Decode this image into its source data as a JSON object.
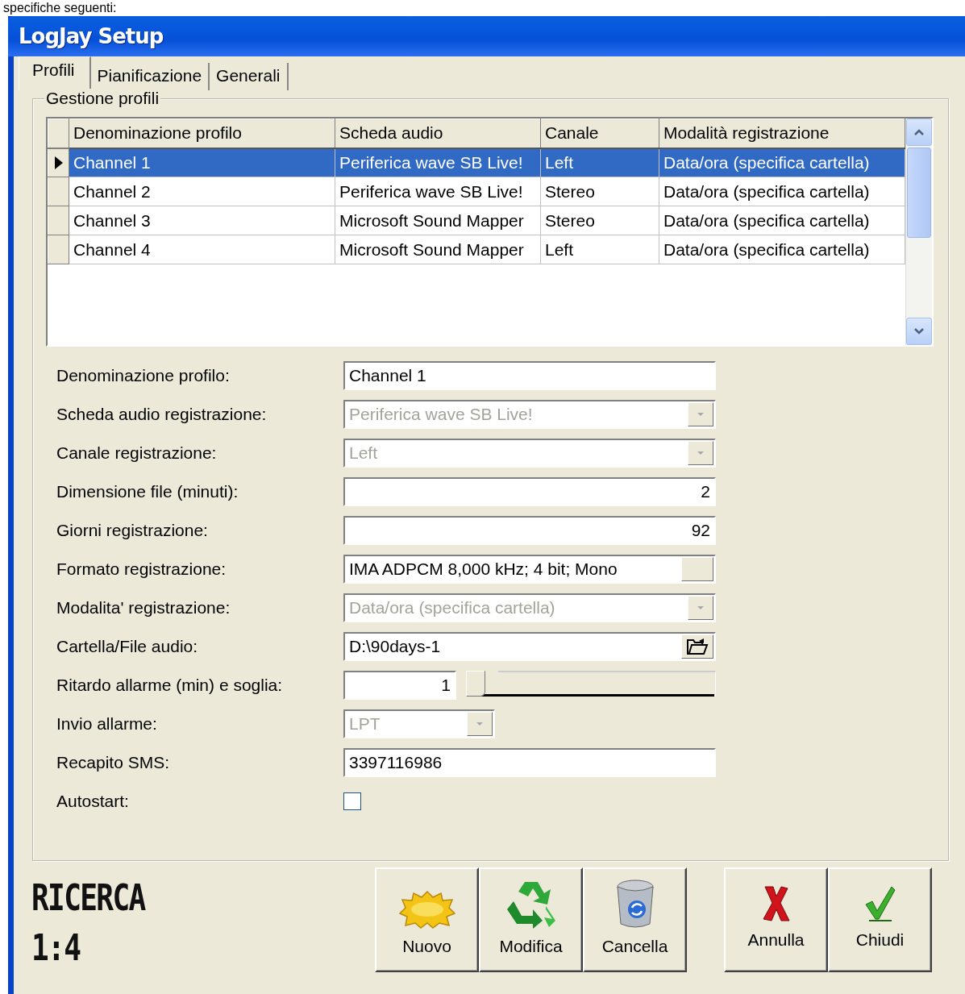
{
  "caption": "specifiche seguenti:",
  "window": {
    "title": "LogJay Setup"
  },
  "tabs": [
    {
      "label": "Profili",
      "selected": true
    },
    {
      "label": "Pianificazione",
      "selected": false
    },
    {
      "label": "Generali",
      "selected": false
    }
  ],
  "group": {
    "title": "Gestione profili"
  },
  "table": {
    "columns": [
      "Denominazione profilo",
      "Scheda audio",
      "Canale",
      "Modalità registrazione"
    ],
    "rows": [
      {
        "cells": [
          "Channel 1",
          "Periferica wave SB Live!",
          "Left",
          "Data/ora (specifica cartella)"
        ],
        "selected": true
      },
      {
        "cells": [
          "Channel 2",
          "Periferica wave SB Live!",
          "Stereo",
          "Data/ora (specifica cartella)"
        ],
        "selected": false
      },
      {
        "cells": [
          "Channel 3",
          "Microsoft Sound Mapper",
          "Stereo",
          "Data/ora (specifica cartella)"
        ],
        "selected": false
      },
      {
        "cells": [
          "Channel 4",
          "Microsoft Sound Mapper",
          "Left",
          "Data/ora (specifica cartella)"
        ],
        "selected": false
      }
    ]
  },
  "form": [
    {
      "label": "Denominazione profilo:",
      "kind": "text",
      "value": "Channel 1"
    },
    {
      "label": "Scheda audio registrazione:",
      "kind": "combo",
      "value": "Periferica wave SB Live!",
      "disabled": true
    },
    {
      "label": "Canale registrazione:",
      "kind": "combo",
      "value": "Left",
      "disabled": true
    },
    {
      "label": "Dimensione file (minuti):",
      "kind": "number",
      "value": "2"
    },
    {
      "label": "Giorni registrazione:",
      "kind": "number",
      "value": "92"
    },
    {
      "label": "Formato registrazione:",
      "kind": "picker",
      "value": "IMA ADPCM 8,000 kHz; 4 bit; Mono"
    },
    {
      "label": "Modalita' registrazione:",
      "kind": "combo",
      "value": "Data/ora (specifica cartella)",
      "disabled": true
    },
    {
      "label": "Cartella/File audio:",
      "kind": "folder",
      "value": "D:\\90days-1"
    },
    {
      "label": "Ritardo allarme (min) e soglia:",
      "kind": "slider",
      "value": "1",
      "level": 0
    },
    {
      "label": "Invio allarme:",
      "kind": "short-combo",
      "value": "LPT",
      "disabled": true
    },
    {
      "label": "Recapito SMS:",
      "kind": "text",
      "value": "3397116986"
    },
    {
      "label": "Autostart:",
      "kind": "checkbox",
      "checked": false
    }
  ],
  "status": {
    "title": "RICERCA",
    "count": "1:4"
  },
  "buttons": [
    {
      "label": "Nuovo",
      "kind": "new"
    },
    {
      "label": "Modifica",
      "kind": "recycle"
    },
    {
      "label": "Cancella",
      "kind": "trash"
    }
  ],
  "dialog_buttons": [
    {
      "label": "Annulla",
      "kind": "cancel"
    },
    {
      "label": "Chiudi",
      "kind": "ok"
    }
  ]
}
